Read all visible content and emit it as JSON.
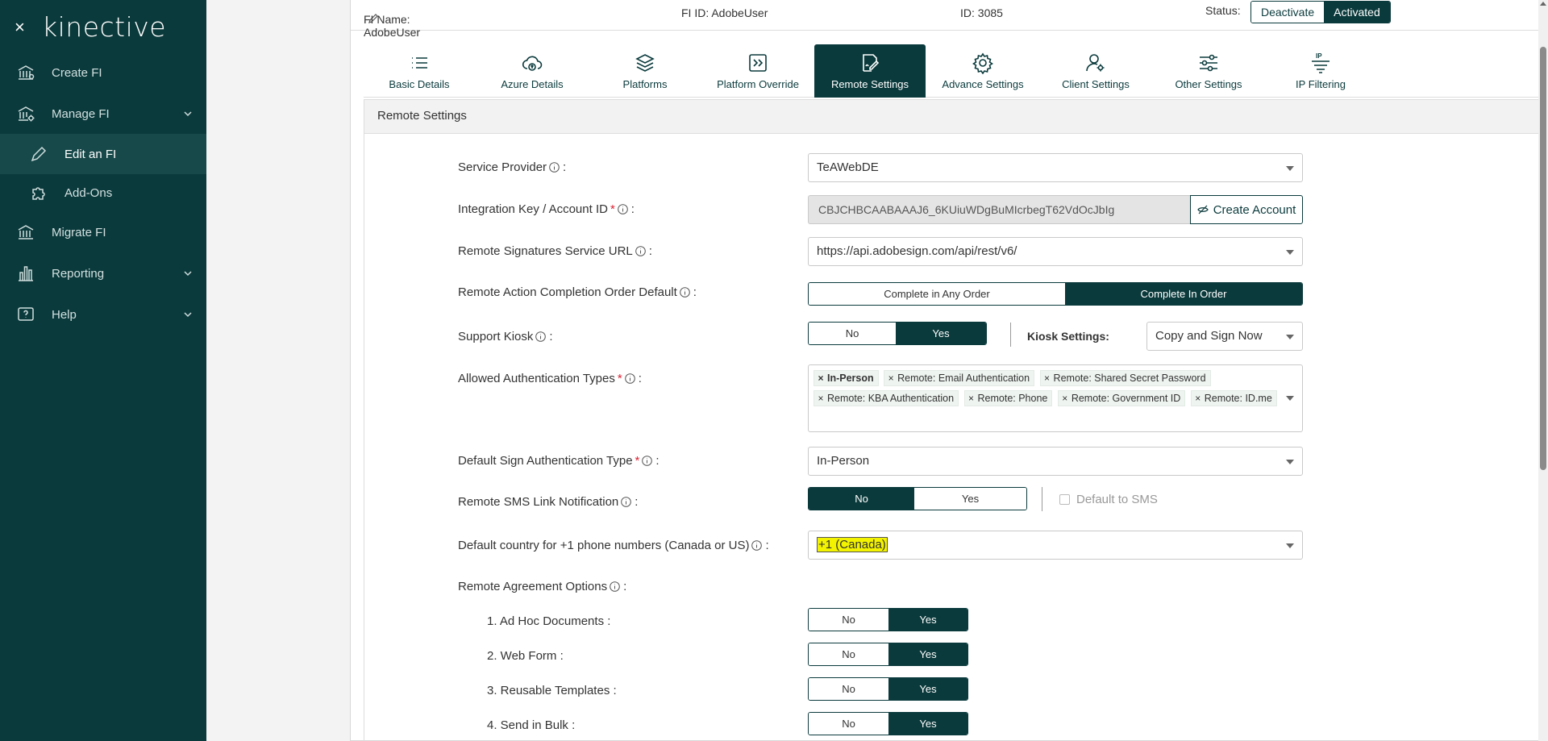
{
  "sidebar": {
    "brand": "kinective",
    "close_icon": "×",
    "items": [
      {
        "label": "Create FI",
        "icon": "bank-icon"
      },
      {
        "label": "Manage FI",
        "icon": "bank-gear-icon"
      },
      {
        "label": "Edit an FI",
        "icon": "pencil-icon"
      },
      {
        "label": "Add-Ons",
        "icon": "puzzle-icon"
      },
      {
        "label": "Migrate FI",
        "icon": "bank-arrow-icon"
      },
      {
        "label": "Reporting",
        "icon": "bar-chart-icon"
      },
      {
        "label": "Help",
        "icon": "help-icon"
      }
    ]
  },
  "header": {
    "fi_name": "FI Name: AdobeUser",
    "fi_id": "FI ID: AdobeUser",
    "id": "ID: 3085",
    "status_label": "Status:",
    "deactivate": "Deactivate",
    "activated": "Activated"
  },
  "tabs": [
    {
      "label": "Basic Details",
      "icon": "list-icon"
    },
    {
      "label": "Azure Details",
      "icon": "cloud-upload-icon"
    },
    {
      "label": "Platforms",
      "icon": "layers-icon"
    },
    {
      "label": "Platform Override",
      "icon": "override-icon"
    },
    {
      "label": "Remote Settings",
      "icon": "remote-sign-icon"
    },
    {
      "label": "Advance Settings",
      "icon": "gear-icon"
    },
    {
      "label": "Client Settings",
      "icon": "user-gear-icon"
    },
    {
      "label": "Other Settings",
      "icon": "sliders-icon"
    },
    {
      "label": "IP Filtering",
      "icon": "ip-filter-icon"
    }
  ],
  "section": {
    "title": "Remote Settings",
    "service_provider": {
      "label": "Service Provider",
      "value": "TeAWebDE"
    },
    "integration_key": {
      "label": "Integration Key / Account ID",
      "value": "CBJCHBCAABAAAJ6_6KUiuWDgBuMIcrbegT62VdOcJbIg",
      "button": "Create Account"
    },
    "service_url": {
      "label": "Remote Signatures Service URL",
      "value": "https://api.adobesign.com/api/rest/v6/"
    },
    "completion_order": {
      "label": "Remote Action Completion Order Default",
      "options": [
        "Complete in Any Order",
        "Complete In Order"
      ],
      "selected": "Complete In Order"
    },
    "support_kiosk": {
      "label": "Support Kiosk",
      "options": [
        "No",
        "Yes"
      ],
      "selected": "Yes",
      "kiosk_label": "Kiosk Settings:",
      "kiosk_value": "Copy and Sign Now"
    },
    "auth_types": {
      "label": "Allowed Authentication Types",
      "chips": [
        "In-Person",
        "Remote: Email Authentication",
        "Remote: Shared Secret Password",
        "Remote: KBA Authentication",
        "Remote: Phone",
        "Remote: Government ID",
        "Remote: ID.me"
      ],
      "remove": "×"
    },
    "default_auth": {
      "label": "Default Sign Authentication Type",
      "value": "In-Person"
    },
    "sms_link": {
      "label": "Remote SMS Link Notification",
      "options": [
        "No",
        "Yes"
      ],
      "selected": "No",
      "checkbox_label": "Default to SMS"
    },
    "default_country": {
      "label": "Default country for +1 phone numbers (Canada or US)",
      "value": "+1 (Canada)"
    },
    "agreement_options": {
      "label": "Remote Agreement Options",
      "items": [
        {
          "label": "1. Ad Hoc Documents :",
          "selected": "Yes"
        },
        {
          "label": "2. Web Form :",
          "selected": "Yes"
        },
        {
          "label": "3. Reusable Templates :",
          "selected": "Yes"
        },
        {
          "label": "4. Send in Bulk :",
          "selected": "Yes"
        }
      ],
      "no": "No",
      "yes": "Yes"
    },
    "colon": ":",
    "required": "*"
  },
  "colors": {
    "primary": "#0b3a3c",
    "highlight": "#f3f300",
    "chip_bg": "#eef4f0"
  }
}
